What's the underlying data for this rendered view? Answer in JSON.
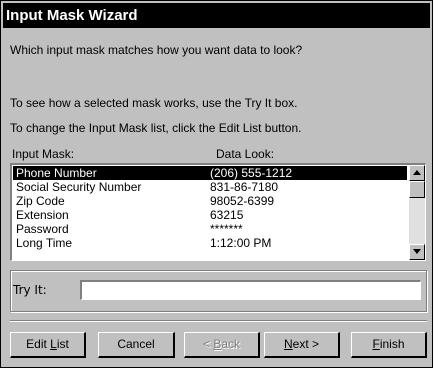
{
  "dialog": {
    "title": "Input Mask Wizard",
    "question": "Which input mask matches how you want data to look?",
    "help1": "To see how a selected mask works, use the Try It box.",
    "help2": "To change the Input Mask list, click the Edit List button."
  },
  "list": {
    "col_mask": "Input Mask:",
    "col_look": "Data Look:",
    "rows": [
      {
        "mask": "Phone Number",
        "look": "(206) 555-1212"
      },
      {
        "mask": "Social Security Number",
        "look": "831-86-7180"
      },
      {
        "mask": "Zip Code",
        "look": "98052-6399"
      },
      {
        "mask": "Extension",
        "look": "63215"
      },
      {
        "mask": "Password",
        "look": "*******"
      },
      {
        "mask": "Long Time",
        "look": "1:12:00 PM"
      }
    ]
  },
  "tryit": {
    "label": "Try It:",
    "value": ""
  },
  "buttons": {
    "edit_list_pre": "Edit ",
    "edit_list_key": "L",
    "edit_list_post": "ist",
    "cancel": "Cancel",
    "back_pre": "< ",
    "back_key": "B",
    "back_post": "ack",
    "next_key": "N",
    "next_post": "ext >",
    "finish_key": "F",
    "finish_post": "inish"
  }
}
